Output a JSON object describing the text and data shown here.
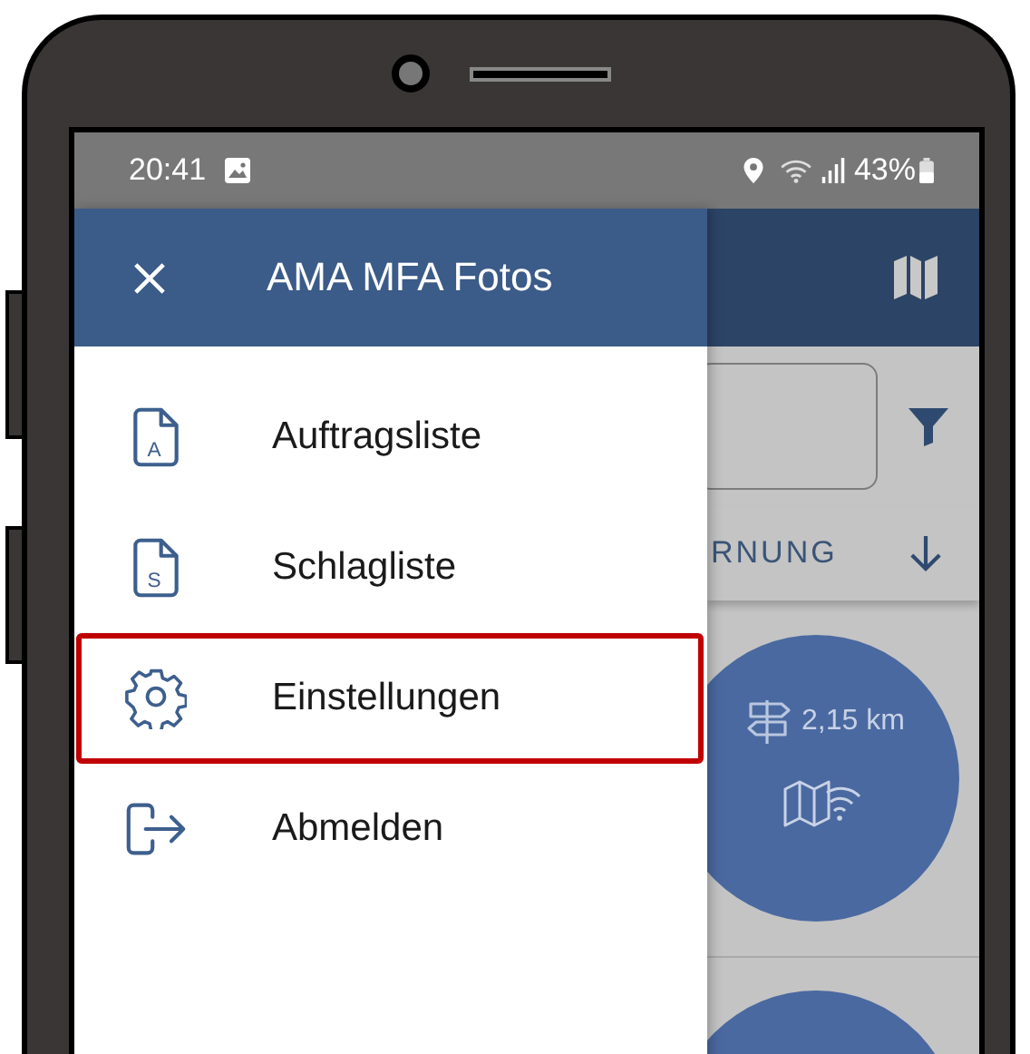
{
  "status_bar": {
    "time": "20:41",
    "battery": "43%"
  },
  "drawer": {
    "title": "AMA MFA Fotos",
    "items": [
      {
        "kind": "document",
        "letter": "A",
        "label": "Auftragsliste",
        "highlighted": false
      },
      {
        "kind": "document",
        "letter": "S",
        "label": "Schlagliste",
        "highlighted": false
      },
      {
        "kind": "settings",
        "label": "Einstellungen",
        "highlighted": true
      },
      {
        "kind": "logout",
        "label": "Abmelden",
        "highlighted": false
      }
    ]
  },
  "background": {
    "sort_label": "RNUNG",
    "distance": "2,15 km"
  }
}
